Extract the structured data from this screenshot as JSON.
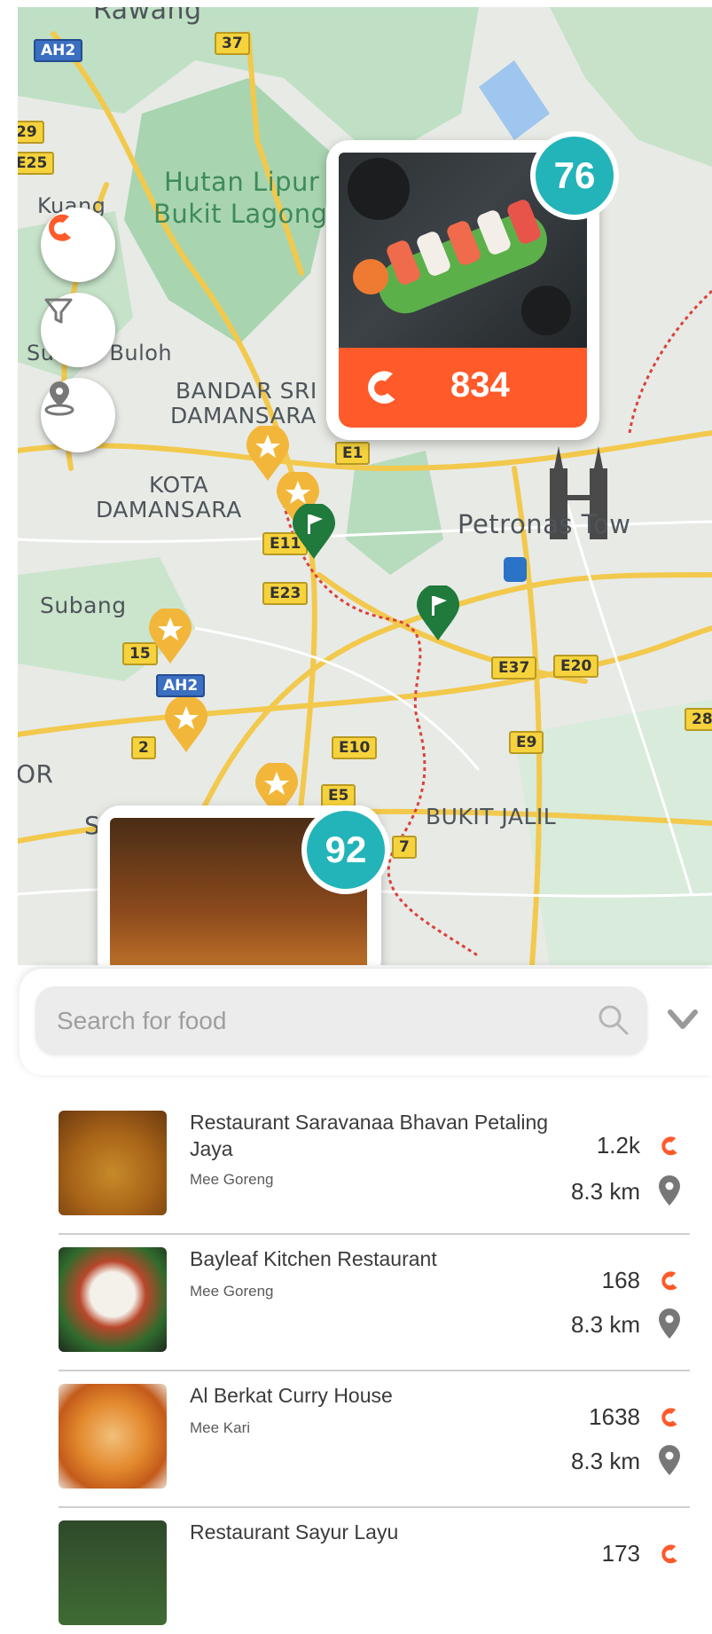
{
  "map": {
    "labels": {
      "rawang": "Rawang",
      "kuang": "Kuang",
      "hutan": "Hutan Lipur",
      "bukit_lagong": "Bukit Lagong",
      "sungai_buloh": "Sungai Buloh",
      "bandar_sri": "BANDAR SRI",
      "damansara1": "DAMANSARA",
      "kota": "KOTA",
      "damansara2": "DAMANSARA",
      "petronas": "Petronas Tow",
      "subang": "Subang",
      "or": "OR",
      "bukit_jalil": "BUKIT JALIL",
      "subang_jaya": "Subang Jaya"
    },
    "roads": {
      "ah2_top": "AH2",
      "r37": "37",
      "r29": "29",
      "e25": "E25",
      "e1": "E1",
      "e11": "E11",
      "e23": "E23",
      "r15": "15",
      "ah2_mid": "AH2",
      "r2": "2",
      "e10": "E10",
      "e5": "E5",
      "e37": "E37",
      "e20": "E20",
      "e9": "E9",
      "r28": "28",
      "r7": "7"
    },
    "colors": {
      "accent": "#ff5a2a",
      "teal": "#23b4b9",
      "pin_yellow": "#f2b73a",
      "flag_green": "#1f7a3c"
    }
  },
  "featured": {
    "rank": "76",
    "score": "834"
  },
  "secondary": {
    "rank": "92"
  },
  "search": {
    "placeholder": "Search for food"
  },
  "results": [
    {
      "name": "Restaurant Saravanaa Bhavan Petaling Jaya",
      "dish": "Mee Goreng",
      "count": "1.2k",
      "distance": "8.3 km"
    },
    {
      "name": "Bayleaf Kitchen Restaurant",
      "dish": "Mee Goreng",
      "count": "168",
      "distance": "8.3 km"
    },
    {
      "name": "Al Berkat Curry House",
      "dish": "Mee Kari",
      "count": "1638",
      "distance": "8.3 km"
    },
    {
      "name": "Restaurant Sayur Layu",
      "dish": "",
      "count": "173",
      "distance": ""
    }
  ]
}
